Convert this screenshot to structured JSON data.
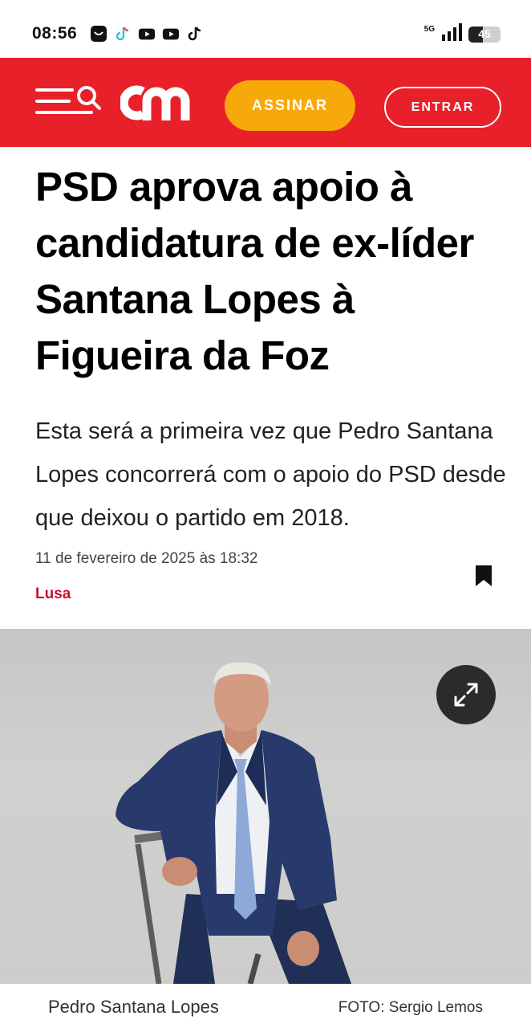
{
  "status_bar": {
    "time": "08:56",
    "network": "5G",
    "battery": "45",
    "battery_level": 0.45,
    "app_icons": [
      "ali-icon",
      "tiktok-icon",
      "youtube-icon",
      "youtube-icon",
      "tiktok-icon"
    ]
  },
  "header": {
    "logo_text": "cm",
    "subscribe_label": "ASSINAR",
    "login_label": "ENTRAR",
    "colors": {
      "brand_red": "#e8202a",
      "accent_orange": "#f8a90a"
    }
  },
  "article": {
    "headline": "PSD aprova apoio à candidatura de ex-líder Santana Lopes à Figueira da Foz",
    "lead": "Esta será a primeira vez que Pedro Santana Lopes concorrerá com o apoio do PSD desde que deixou o partido em 2018.",
    "date": "11 de fevereiro de 2025 às 18:32",
    "author": "Lusa"
  },
  "photo": {
    "caption": "Pedro Santana Lopes",
    "credit": "FOTO: Sergio Lemos"
  }
}
